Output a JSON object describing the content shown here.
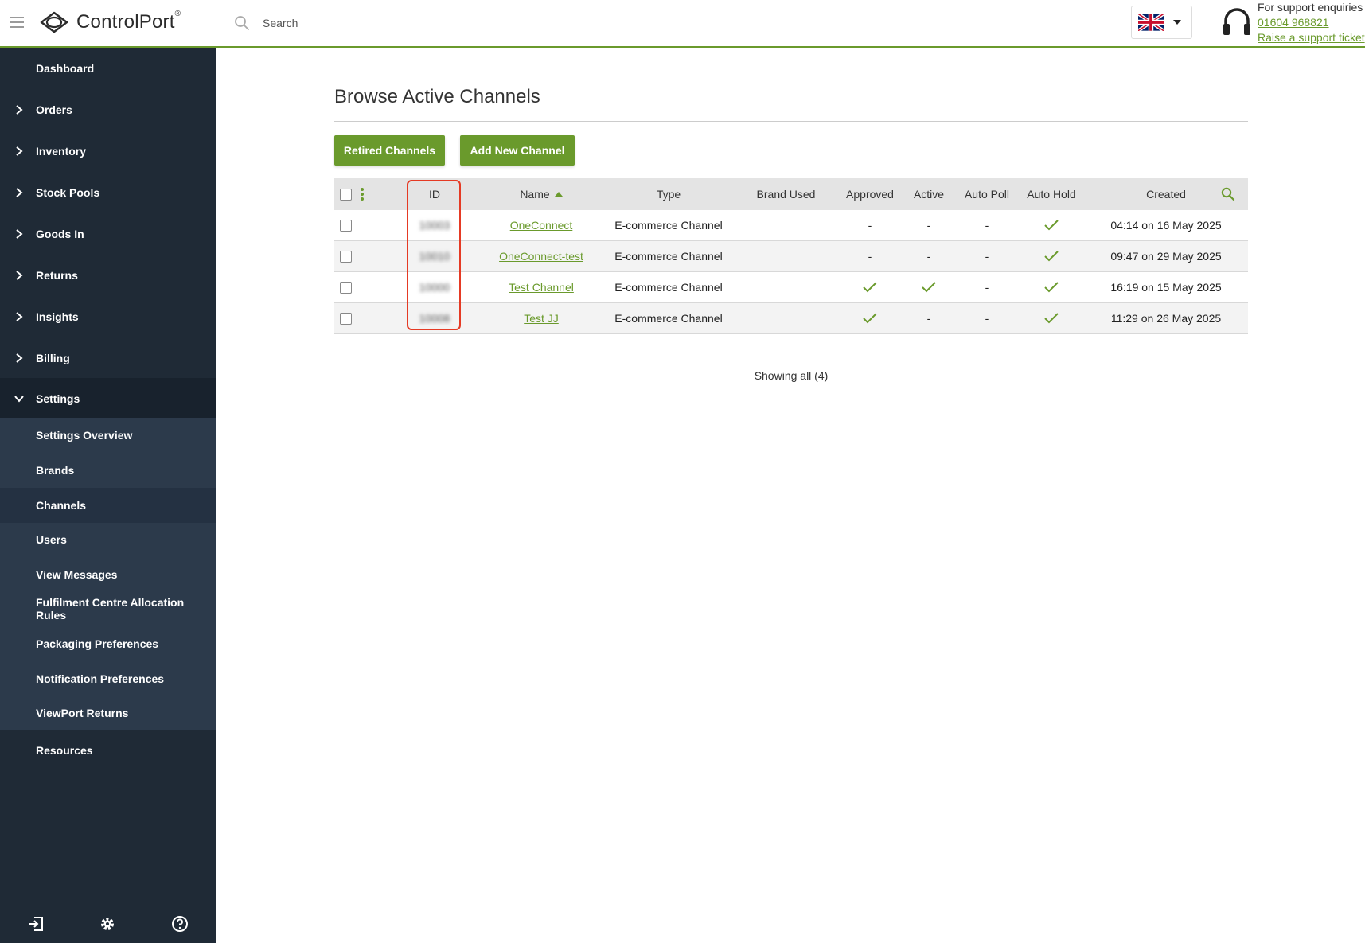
{
  "header": {
    "logo_text": "ControlPort",
    "logo_reg": "®",
    "search_placeholder": "Search",
    "support_label": "For support enquiries",
    "support_phone": "01604 968821",
    "support_ticket": "Raise a support ticket"
  },
  "sidebar": {
    "items": [
      {
        "label": "Dashboard"
      },
      {
        "label": "Orders"
      },
      {
        "label": "Inventory"
      },
      {
        "label": "Stock Pools"
      },
      {
        "label": "Goods In"
      },
      {
        "label": "Returns"
      },
      {
        "label": "Insights"
      },
      {
        "label": "Billing"
      },
      {
        "label": "Settings"
      }
    ],
    "settings_sub": [
      {
        "label": "Settings Overview"
      },
      {
        "label": "Brands"
      },
      {
        "label": "Channels"
      },
      {
        "label": "Users"
      },
      {
        "label": "View Messages"
      },
      {
        "label": "Fulfilment Centre Allocation Rules"
      },
      {
        "label": "Packaging Preferences"
      },
      {
        "label": "Notification Preferences"
      },
      {
        "label": "ViewPort Returns"
      }
    ],
    "resources": "Resources"
  },
  "main": {
    "title": "Browse Active Channels",
    "retired_button": "Retired Channels",
    "add_button": "Add New Channel",
    "columns": {
      "id": "ID",
      "name": "Name",
      "type": "Type",
      "brand": "Brand Used",
      "approved": "Approved",
      "active": "Active",
      "auto_poll": "Auto Poll",
      "auto_hold": "Auto Hold",
      "created": "Created"
    },
    "rows": [
      {
        "id": "10003",
        "name": "OneConnect",
        "type": "E-commerce Channel",
        "brand": "",
        "approved": "-",
        "active": "-",
        "auto_poll": "-",
        "auto_hold": "check",
        "created": "04:14 on 16 May 2025"
      },
      {
        "id": "10010",
        "name": "OneConnect-test",
        "type": "E-commerce Channel",
        "brand": "",
        "approved": "-",
        "active": "-",
        "auto_poll": "-",
        "auto_hold": "check",
        "created": "09:47 on 29 May 2025"
      },
      {
        "id": "10000",
        "name": "Test Channel",
        "type": "E-commerce Channel",
        "brand": "",
        "approved": "check",
        "active": "check",
        "auto_poll": "-",
        "auto_hold": "check",
        "created": "16:19 on 15 May 2025"
      },
      {
        "id": "10008",
        "name": "Test JJ",
        "type": "E-commerce Channel",
        "brand": "",
        "approved": "check",
        "active": "-",
        "auto_poll": "-",
        "auto_hold": "check",
        "created": "11:29 on 26 May 2025"
      }
    ],
    "showing": "Showing all (4)"
  },
  "colors": {
    "accent": "#6a9a2c",
    "sidebar_bg": "#1f2a36",
    "submenu_bg": "#2c3a4b",
    "highlight": "#e53a24"
  }
}
